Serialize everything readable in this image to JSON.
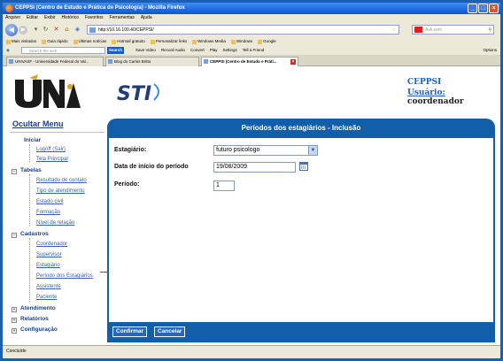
{
  "window": {
    "title": "CEPPSI (Centro de Estudo e Prática de Psicologia) - Mozilla Firefox"
  },
  "menu": [
    "Arquivo",
    "Editar",
    "Exibir",
    "Histórico",
    "Favoritos",
    "Ferramentas",
    "Ajuda"
  ],
  "nav": {
    "url": "http://10.16.100.40/CEPPSI/",
    "search_placeholder": "Ask.com"
  },
  "bookmarks": [
    "Mais visitados",
    "Guia rápido",
    "Últimas notícias",
    "Hotmail gratuito",
    "Personalizar links",
    "Windows Media",
    "Windows",
    "Google"
  ],
  "toolbar": {
    "search_placeholder": "Search the web",
    "search_button": "Search",
    "items": [
      "Save Video",
      "Record Audio",
      "Convert",
      "Play",
      "Settings",
      "Tell a Friend"
    ],
    "options": "Options"
  },
  "tabs": [
    {
      "label": "UNIVASF - Universidade Federal do Val..."
    },
    {
      "label": "Blog do Carlos Britto"
    },
    {
      "label": "CEPPSI (Centro de Estudo e Práti..."
    }
  ],
  "header": {
    "logo_univasf": "UNIVASF",
    "logo_sti": "STI",
    "app_name": "CEPPSI",
    "user_label": "Usuário:",
    "user_name": "coordenador"
  },
  "sidebar": {
    "hide_menu": "Ocultar Menu",
    "inicio": {
      "title": "Iniciar",
      "items": [
        "Logoff (Sair)",
        "Tela Principal"
      ]
    },
    "tabelas": {
      "title": "Tabelas",
      "items": [
        "Resultado de contato",
        "Tipo de atendimento",
        "Estado civil",
        "Formação",
        "Nível de relação"
      ]
    },
    "cadastros": {
      "title": "Cadastros",
      "items": [
        "Coordenador",
        "Supervisor",
        "Estagiário",
        "Período dos Estagiários",
        "Assistente",
        "Paciente"
      ]
    },
    "atendimento": "Atendimento",
    "relatorios": "Relatórios",
    "configuracao": "Configuração"
  },
  "form": {
    "title": "Períodos dos estagiários - Inclusão",
    "estagiario_label": "Estagiário:",
    "estagiario_value": "futuro psicologo",
    "data_label": "Data de início do período",
    "data_value": "19/08/2009",
    "periodo_label": "Período:",
    "periodo_value": "1",
    "confirm_button": "Confirmar",
    "cancel_button": "Cancelar"
  },
  "status": {
    "text": "Concluído"
  }
}
